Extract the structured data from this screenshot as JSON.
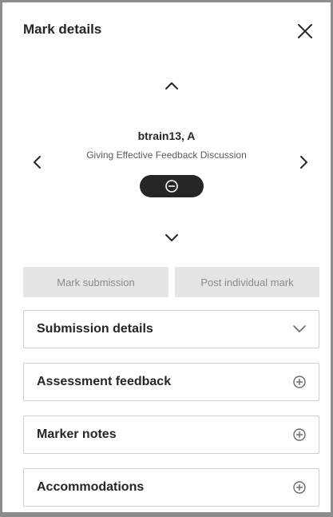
{
  "header": {
    "title": "Mark details"
  },
  "student": {
    "name": "btrain13, A",
    "assignment": "Giving Effective Feedback Discussion"
  },
  "actions": {
    "mark_label": "Mark submission",
    "post_label": "Post individual mark"
  },
  "sections": [
    {
      "label": "Submission details",
      "icon": "chevron-down-icon"
    },
    {
      "label": "Assessment feedback",
      "icon": "plus-circle-icon"
    },
    {
      "label": "Marker notes",
      "icon": "plus-circle-icon"
    },
    {
      "label": "Accommodations",
      "icon": "plus-circle-icon"
    }
  ],
  "colors": {
    "text": "#262626",
    "muted_text": "#5c5c5c",
    "pill": "#262626",
    "disabled_button_bg": "#e5e5e5",
    "disabled_button_text": "#8a8a8a",
    "border": "#cfcfcf",
    "frame": "#8c8c8c"
  }
}
